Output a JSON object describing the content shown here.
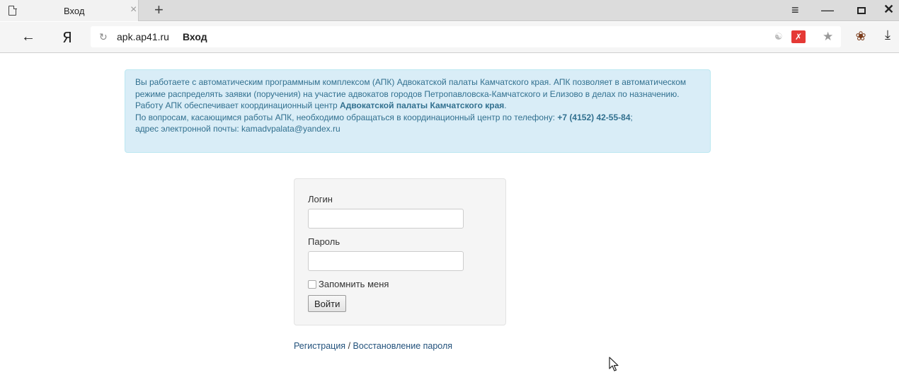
{
  "browser": {
    "tab_title": "Вход",
    "tab_close": "×",
    "new_tab": "+",
    "url_host": "apk.ap41.ru",
    "url_title": "Вход",
    "yandex_logo": "Я",
    "icons": [
      "page-icon",
      "back-arrow-icon",
      "reload-icon",
      "translate-icon",
      "extension-icon",
      "star-icon",
      "bug-icon",
      "download-icon",
      "menu-icon",
      "minimize-icon",
      "maximize-icon",
      "close-icon",
      "cursor-icon"
    ]
  },
  "info": {
    "intro": "Вы работаете с автоматическим программным комплексом (АПК) Адвокатской палаты Камчатского края. АПК позволяет в автоматическом режиме распределять заявки (поручения) на участие адвокатов городов Петропавловска-Камчатского и Елизово в делах по назначению. Работу АПК обеспечивает координационный центр",
    "org": "Адвокатской палаты Камчатского края",
    "questions": "По вопросам, касающимся работы АПК, необходимо обращаться в координационный центр по телефону:",
    "phone": "+7 (4152) 42-55-84",
    "email_prefix": "адрес электронной почты:",
    "email": "kamadvpalata@yandex.ru"
  },
  "login_form": {
    "login_label": "Логин",
    "login_value": "",
    "password_label": "Пароль",
    "password_value": "",
    "remember_label": "Запомнить меня",
    "remember_checked": false,
    "submit_label": "Войти"
  },
  "links": {
    "register": "Регистрация",
    "separator": "/",
    "restore": "Восстановление пароля"
  },
  "colors": {
    "info_bg": "#d9edf7",
    "info_text": "#31708f",
    "link": "#23527c"
  }
}
